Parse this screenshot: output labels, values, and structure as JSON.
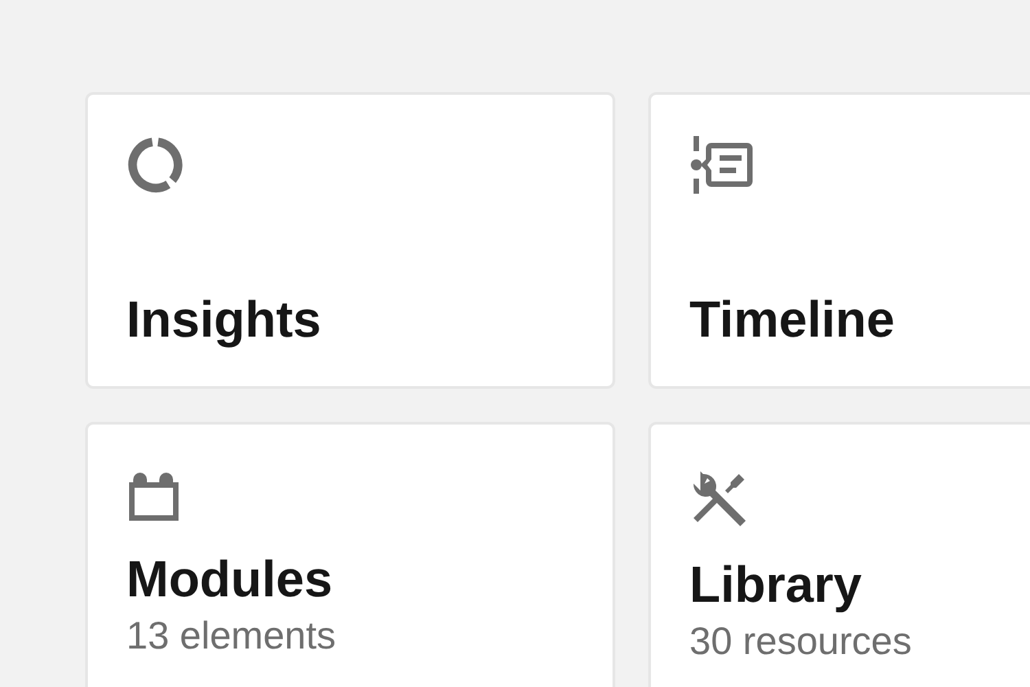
{
  "cards": [
    {
      "title": "Insights"
    },
    {
      "title": "Timeline"
    },
    {
      "title": "Modules",
      "subtitle": "13 elements"
    },
    {
      "title": "Library",
      "subtitle": "30 resources"
    }
  ]
}
